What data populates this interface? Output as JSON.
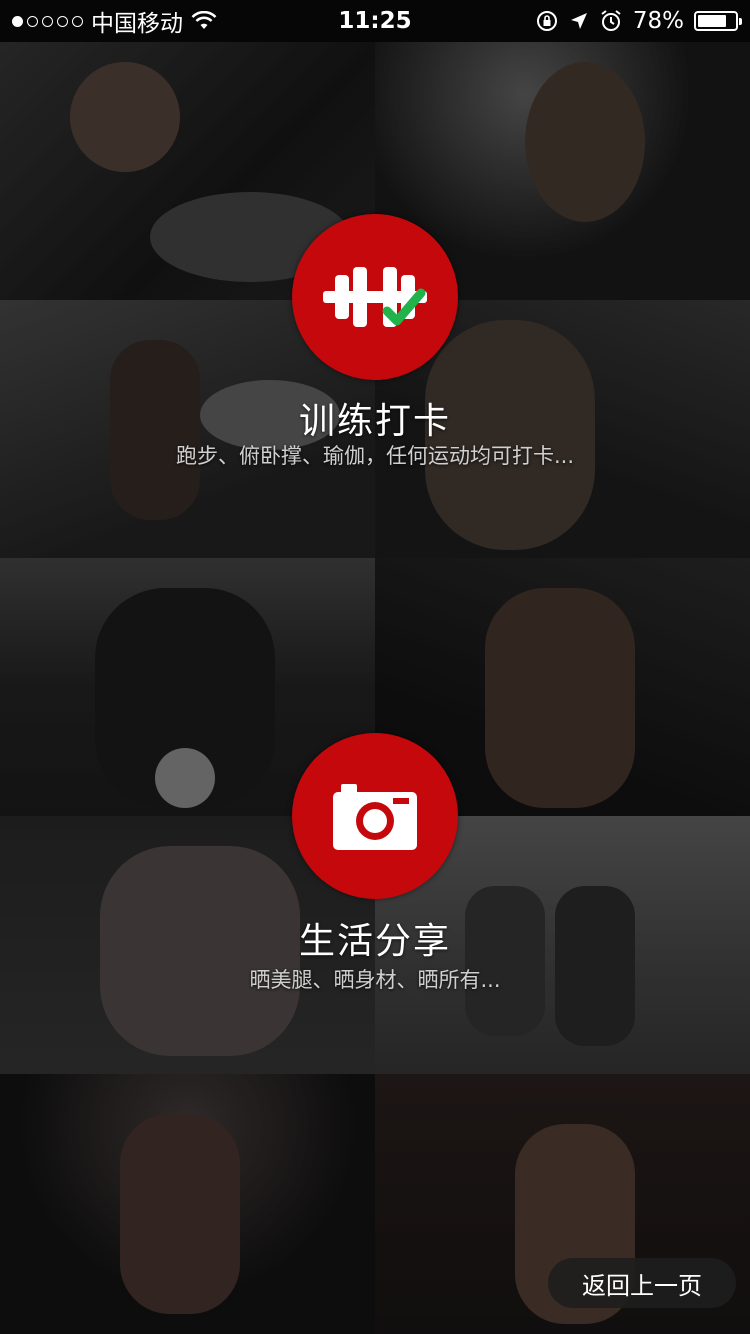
{
  "status_bar": {
    "carrier": "中国移动",
    "time": "11:25",
    "battery": "78%",
    "battery_level": 0.78,
    "signal_strength": 1,
    "signal_total": 5,
    "icons": [
      "wifi-icon",
      "rotation-lock-icon",
      "location-icon",
      "alarm-icon",
      "battery-icon"
    ]
  },
  "features": [
    {
      "title": "训练打卡",
      "subtitle": "跑步、俯卧撑、瑜伽，任何运动均可打卡...",
      "icon": "dumbbell-check-icon"
    },
    {
      "title": "生活分享",
      "subtitle": "晒美腿、晒身材、晒所有...",
      "icon": "camera-icon"
    }
  ],
  "back_button": {
    "label": "返回上一页"
  },
  "colors": {
    "accent": "#c5080c",
    "check": "#22b24c",
    "background": "#0b0b0b"
  }
}
